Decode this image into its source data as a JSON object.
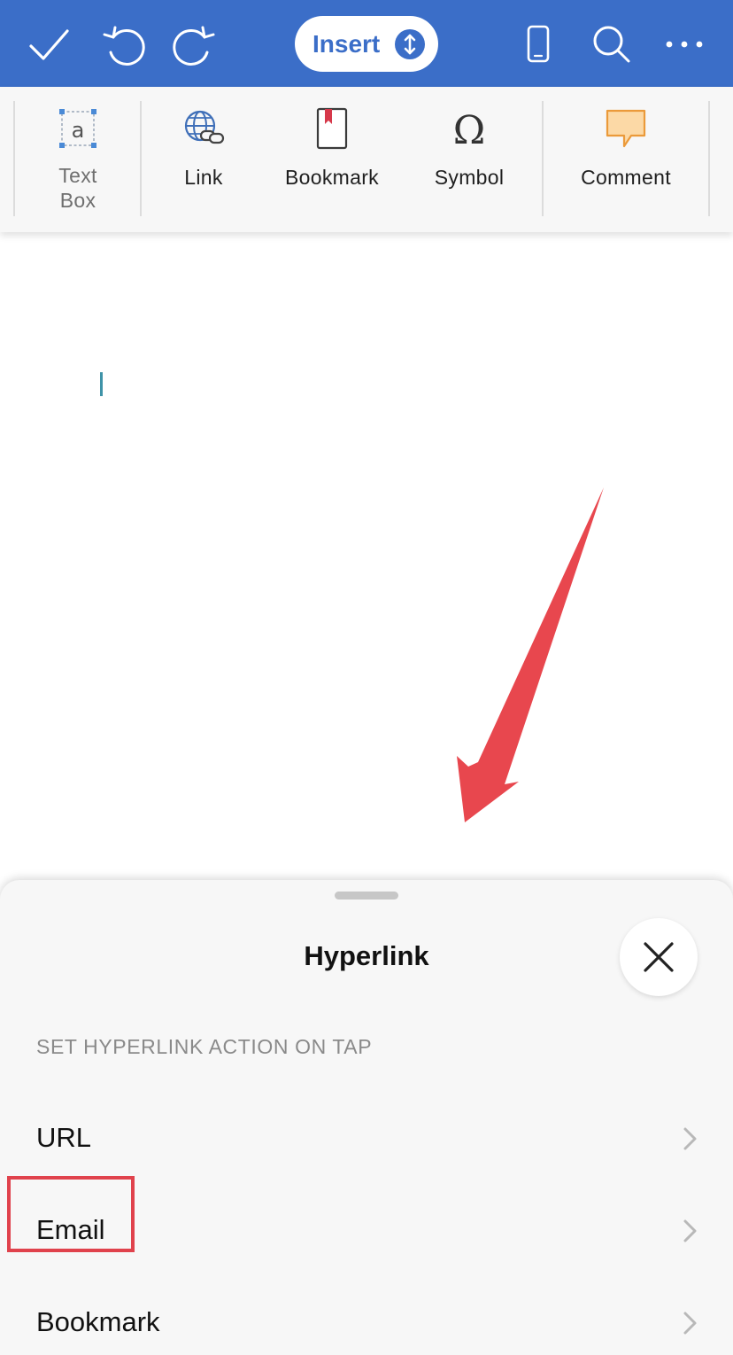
{
  "toolbar": {
    "mode_label": "Insert",
    "icons": [
      "checkmark-icon",
      "undo-icon",
      "redo-icon",
      "phone-view-icon",
      "search-icon",
      "more-icon"
    ],
    "accent_color": "#3b6ec8"
  },
  "ribbon": {
    "items": [
      {
        "label": "Text Box",
        "icon": "text-box-icon"
      },
      {
        "label": "Link",
        "icon": "link-globe-icon"
      },
      {
        "label": "Bookmark",
        "icon": "bookmark-icon"
      },
      {
        "label": "Symbol",
        "icon": "omega-icon"
      },
      {
        "label": "Comment",
        "icon": "comment-icon"
      }
    ]
  },
  "sheet": {
    "title": "Hyperlink",
    "section_header": "SET HYPERLINK ACTION ON TAP",
    "options": [
      {
        "label": "URL"
      },
      {
        "label": "Email"
      },
      {
        "label": "Bookmark"
      }
    ],
    "highlight_color": "#e0424c"
  }
}
